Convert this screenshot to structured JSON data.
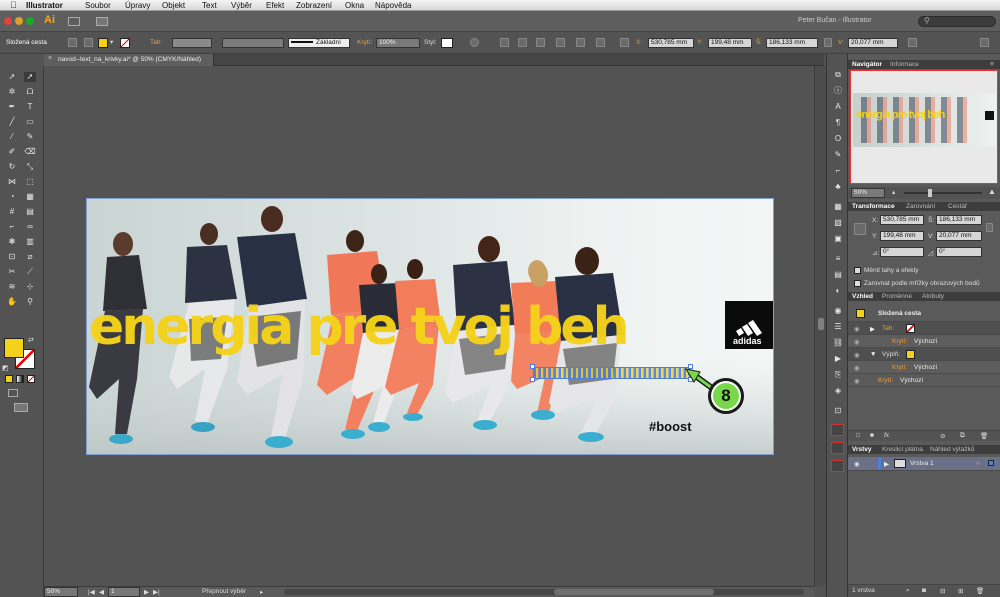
{
  "menubar": {
    "app_name": "Illustrator",
    "items": [
      "Soubor",
      "Úpravy",
      "Objekt",
      "Text",
      "Výběr",
      "Efekt",
      "Zobrazení",
      "Okna",
      "Nápověda"
    ]
  },
  "appbar": {
    "logo": "Ai",
    "workspace_user": "Peter Bučan - Illustrator"
  },
  "control_bar": {
    "selection_type": "Složená cesta",
    "stroke_label": "Tah:",
    "stroke_profile": "Základní",
    "opacity_label": "Krytí:",
    "opacity_value": "100%",
    "style_label": "Styl:",
    "x_label": "X:",
    "x_value": "530,785 mm",
    "y_label": "Y:",
    "y_value": "199,48 mm",
    "w_label": "Š:",
    "w_value": "186,133 mm",
    "h_label": "V:",
    "h_value": "20,077 mm"
  },
  "document_tab": {
    "title": "navod--text_na_krivky.ai* @ 50% (CMYK/Náhled)"
  },
  "artwork": {
    "headline": "energia pre tvoj beh",
    "brand": "adidas",
    "hashtag": "#boost",
    "callout_number": "8"
  },
  "statusbar": {
    "zoom": "50%",
    "artboard_index": "1",
    "status_text": "Přepnout výběr"
  },
  "navigator": {
    "tabs": [
      "Navigátor",
      "Informace"
    ],
    "zoom": "50%"
  },
  "transform": {
    "tabs": [
      "Transformace",
      "Zarovnání",
      "Cestář"
    ],
    "x_label": "X:",
    "x_value": "530,785 mm",
    "y_label": "Y:",
    "y_value": "199,48 mm",
    "w_label": "Š:",
    "w_value": "186,133 mm",
    "h_label": "V:",
    "h_value": "20,077 mm",
    "angle_label": "⊿:",
    "angle_value": "0°",
    "shear_label": "◿:",
    "shear_value": "0°",
    "opt1": "Měnit tahy a efekty",
    "opt2": "Zarovnat podle mřížky obrazových bodů"
  },
  "appearance": {
    "tabs": [
      "Vzhled",
      "Proměnné",
      "Atributy"
    ],
    "object_label": "Složená cesta",
    "stroke_row": "Tah:",
    "opacity_label": "Krytí:",
    "opacity_value": "Výchozí",
    "fill_row": "Výplň:",
    "opacity2_label": "Krytí:",
    "opacity2_value": "Výchozí",
    "opacity3_label": "Krytí:",
    "opacity3_value": "Výchozí",
    "fx_label": "fx"
  },
  "layers": {
    "tabs": [
      "Vrstvy",
      "Kreslicí plátna",
      "Náhled výtažků"
    ],
    "layer_name": "Vrstva 1",
    "count": "1 vrstva"
  },
  "colors": {
    "accent_yellow": "#f5d21a",
    "callout_green": "#78d84a",
    "selection_blue": "#4c7fe0"
  }
}
